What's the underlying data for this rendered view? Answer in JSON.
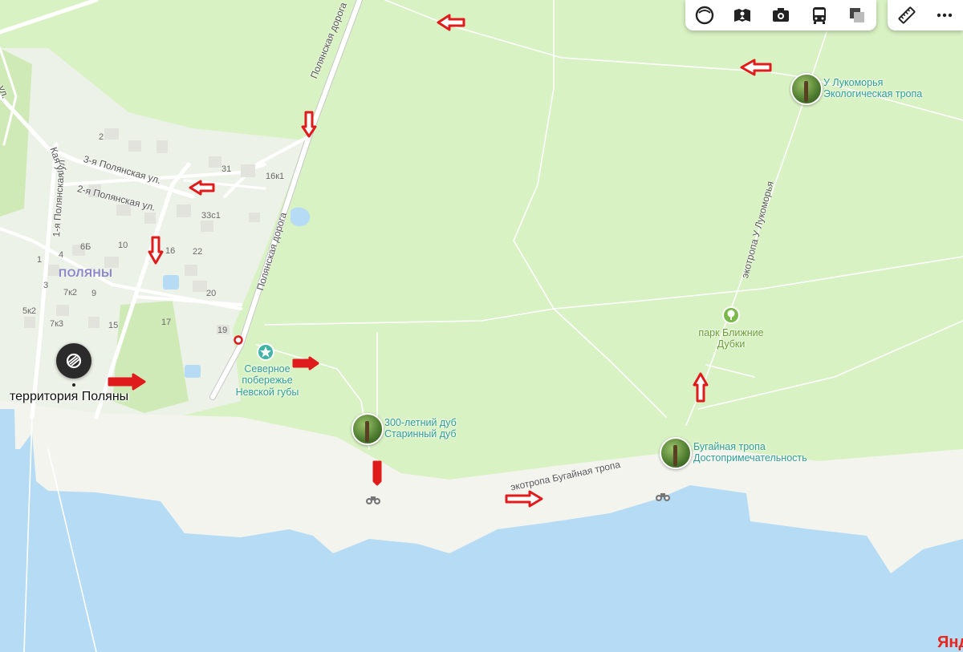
{
  "streets": {
    "polyanskaya_road_north": "Полянская дорога",
    "polyanskaya_road_south": "Полянская дорога",
    "street_3": "3-я Полянская ул.",
    "street_2": "2-я Полянская ул.",
    "street_1": "1-я Полянская ул",
    "street_edge_ul": "ул.",
    "street_edge_yl": "Кая ул",
    "ecotrail_lukomorye": "экотропа У Лукоморья",
    "ecotrail_bugainaya": "экотропа Бугайная тропа"
  },
  "houses": [
    "2",
    "31",
    "16к1",
    "33с1",
    "10",
    "6Б",
    "4",
    "1",
    "16",
    "22",
    "7к2",
    "9",
    "3",
    "20",
    "5к2",
    "7к3",
    "15",
    "17",
    "19"
  ],
  "settlement": "ПОЛЯНЫ",
  "pois": {
    "territory": "территория Поляны",
    "north_coast": [
      "Северное",
      "побережье",
      "Невской губы"
    ],
    "oak_title": "300-летний дуб",
    "oak_subtitle": "Старинный дуб",
    "park": [
      "парк Ближние",
      "Дубки"
    ],
    "lukomorye_title": "У Лукоморья",
    "lukomorye_subtitle": "Экологическая тропа",
    "bugainaya_title": "Бугайная тропа",
    "bugainaya_subtitle": "Достопримечательность"
  },
  "toolbar": {
    "buttons": [
      "layers-icon",
      "panorama-icon",
      "camera-icon",
      "bus-icon",
      "map-style-icon"
    ],
    "ruler": "ruler-icon",
    "more": "more-icon"
  },
  "brand": "Янд",
  "colors": {
    "land": "#d9f2c4",
    "beach": "#f3f4ee",
    "water": "#b5dcf4",
    "road": "#ffffff",
    "marker_red": "#e01b1b",
    "poi_teal": "#2f9e94"
  }
}
